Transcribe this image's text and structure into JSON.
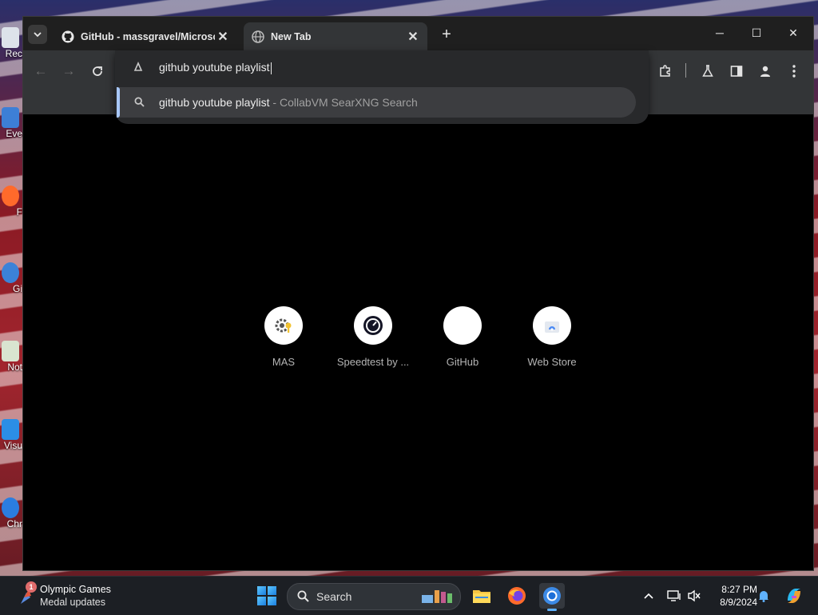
{
  "desktop": {
    "icons": [
      {
        "label": "Rec",
        "icon": "recycle-bin-icon"
      },
      {
        "label": "Eve",
        "icon": "shortcut-icon"
      },
      {
        "label": "F",
        "icon": "firefox-icon"
      },
      {
        "label": "Gi",
        "icon": "github-icon"
      },
      {
        "label": "Not",
        "icon": "notepad-icon"
      },
      {
        "label": "Visu",
        "icon": "vscode-icon"
      },
      {
        "label": "Chr",
        "icon": "chrome-icon"
      }
    ]
  },
  "browser": {
    "tabs": [
      {
        "title": "GitHub - massgravel/Microsof",
        "icon": "github-icon",
        "active": false
      },
      {
        "title": "New Tab",
        "icon": "globe-icon",
        "active": true
      }
    ],
    "window_controls": {
      "minimize": "─",
      "maximize": "☐",
      "close": "✕"
    },
    "omnibox": {
      "text": "github youtube playlist",
      "suggestion_query": "github youtube playlist",
      "suggestion_separator": " - ",
      "suggestion_source": "CollabVM SearXNG Search"
    },
    "shortcuts": [
      {
        "label": "MAS",
        "icon": "gear-key-icon"
      },
      {
        "label": "Speedtest by ...",
        "icon": "speedometer-icon"
      },
      {
        "label": "GitHub",
        "icon": "github-icon"
      },
      {
        "label": "Web Store",
        "icon": "web-store-icon"
      }
    ]
  },
  "taskbar": {
    "widget": {
      "title": "Olympic Games",
      "subtitle": "Medal updates",
      "badge": "1"
    },
    "search_label": "Search",
    "clock": {
      "time": "8:27 PM",
      "date": "8/9/2024"
    }
  },
  "colors": {
    "accent": "#a8c7fa",
    "tabstrip": "#1f1f1f",
    "toolbar": "#333537",
    "taskbar": "#1c1f24"
  }
}
